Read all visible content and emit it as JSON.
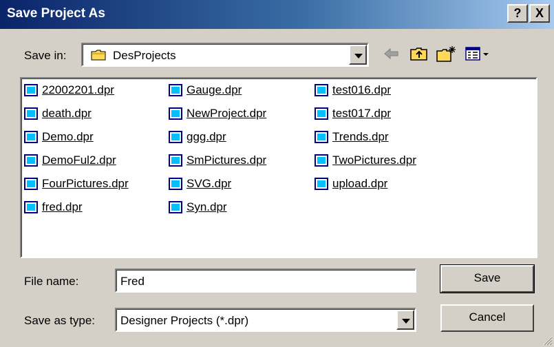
{
  "window": {
    "title": "Save Project As",
    "help_label": "?",
    "close_label": "X"
  },
  "toolbar": {
    "save_in_label": "Save in:",
    "save_in_value": "DesProjects",
    "icons": [
      "folder-icon",
      "back-arrow-icon",
      "up-one-level-icon",
      "new-folder-icon",
      "views-menu-icon"
    ]
  },
  "files": {
    "columns": [
      [
        "22002201.dpr",
        "death.dpr",
        "Demo.dpr",
        "DemoFul2.dpr",
        "FourPictures.dpr",
        "fred.dpr"
      ],
      [
        "Gauge.dpr",
        "NewProject.dpr",
        "ggg.dpr",
        "SmPictures.dpr",
        "SVG.dpr",
        "Syn.dpr"
      ],
      [
        "test016.dpr",
        "test017.dpr",
        "Trends.dpr",
        "TwoPictures.dpr",
        "upload.dpr"
      ]
    ]
  },
  "form": {
    "file_name_label": "File name:",
    "file_name_value": "Fred",
    "save_type_label": "Save as type:",
    "save_type_value": "Designer Projects (*.dpr)",
    "save_button": "Save",
    "cancel_button": "Cancel"
  },
  "colors": {
    "title_start": "#0a246a",
    "title_end": "#a6caf0",
    "face": "#d4d0c8",
    "file_icon": "#00c0ff"
  }
}
